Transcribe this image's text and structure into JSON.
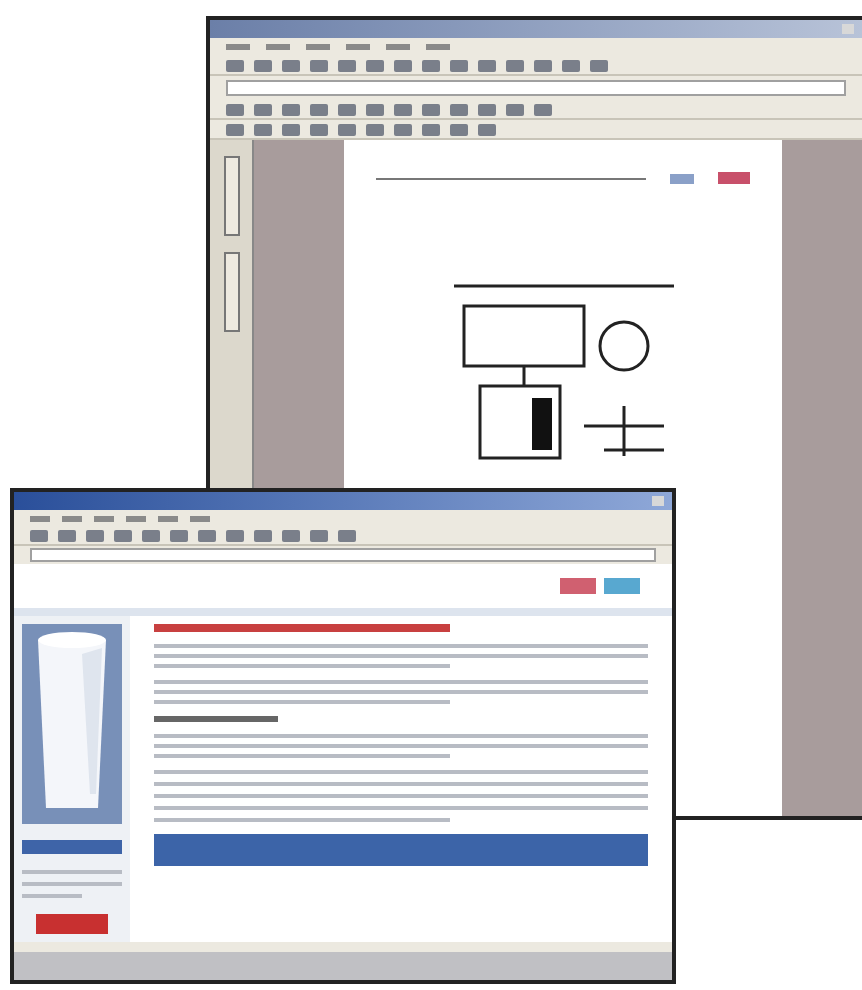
{
  "windows": [
    {
      "kind": "document_viewer",
      "active": false
    },
    {
      "kind": "browser",
      "active": true
    }
  ]
}
